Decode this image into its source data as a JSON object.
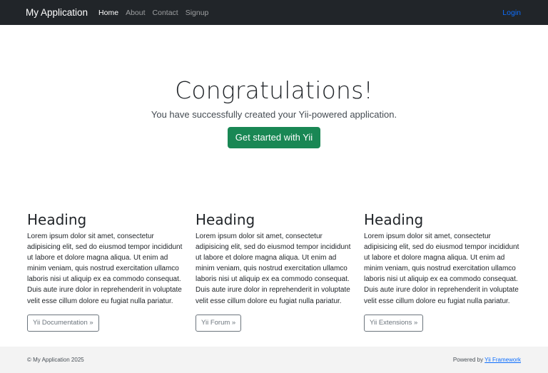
{
  "navbar": {
    "brand": "My Application",
    "items": [
      {
        "label": "Home"
      },
      {
        "label": "About"
      },
      {
        "label": "Contact"
      },
      {
        "label": "Signup"
      }
    ],
    "login": "Login"
  },
  "hero": {
    "title": "Congratulations!",
    "lead": "You have successfully created your Yii-powered application.",
    "button": "Get started with Yii"
  },
  "columns": [
    {
      "heading": "Heading",
      "text": "Lorem ipsum dolor sit amet, consectetur adipisicing elit, sed do eiusmod tempor incididunt ut labore et dolore magna aliqua. Ut enim ad minim veniam, quis nostrud exercitation ullamco laboris nisi ut aliquip ex ea commodo consequat. Duis aute irure dolor in reprehenderit in voluptate velit esse cillum dolore eu fugiat nulla pariatur.",
      "button": "Yii Documentation »"
    },
    {
      "heading": "Heading",
      "text": "Lorem ipsum dolor sit amet, consectetur adipisicing elit, sed do eiusmod tempor incididunt ut labore et dolore magna aliqua. Ut enim ad minim veniam, quis nostrud exercitation ullamco laboris nisi ut aliquip ex ea commodo consequat. Duis aute irure dolor in reprehenderit in voluptate velit esse cillum dolore eu fugiat nulla pariatur.",
      "button": "Yii Forum »"
    },
    {
      "heading": "Heading",
      "text": "Lorem ipsum dolor sit amet, consectetur adipisicing elit, sed do eiusmod tempor incididunt ut labore et dolore magna aliqua. Ut enim ad minim veniam, quis nostrud exercitation ullamco laboris nisi ut aliquip ex ea commodo consequat. Duis aute irure dolor in reprehenderit in voluptate velit esse cillum dolore eu fugiat nulla pariatur.",
      "button": "Yii Extensions »"
    }
  ],
  "footer": {
    "copyright": "© My Application 2025",
    "powered_prefix": "Powered by ",
    "powered_link": "Yii Framework"
  },
  "colors": {
    "navbar_bg": "#212529",
    "accent_link": "#0d6efd",
    "success": "#198754",
    "footer_bg": "#f3f3f3"
  }
}
